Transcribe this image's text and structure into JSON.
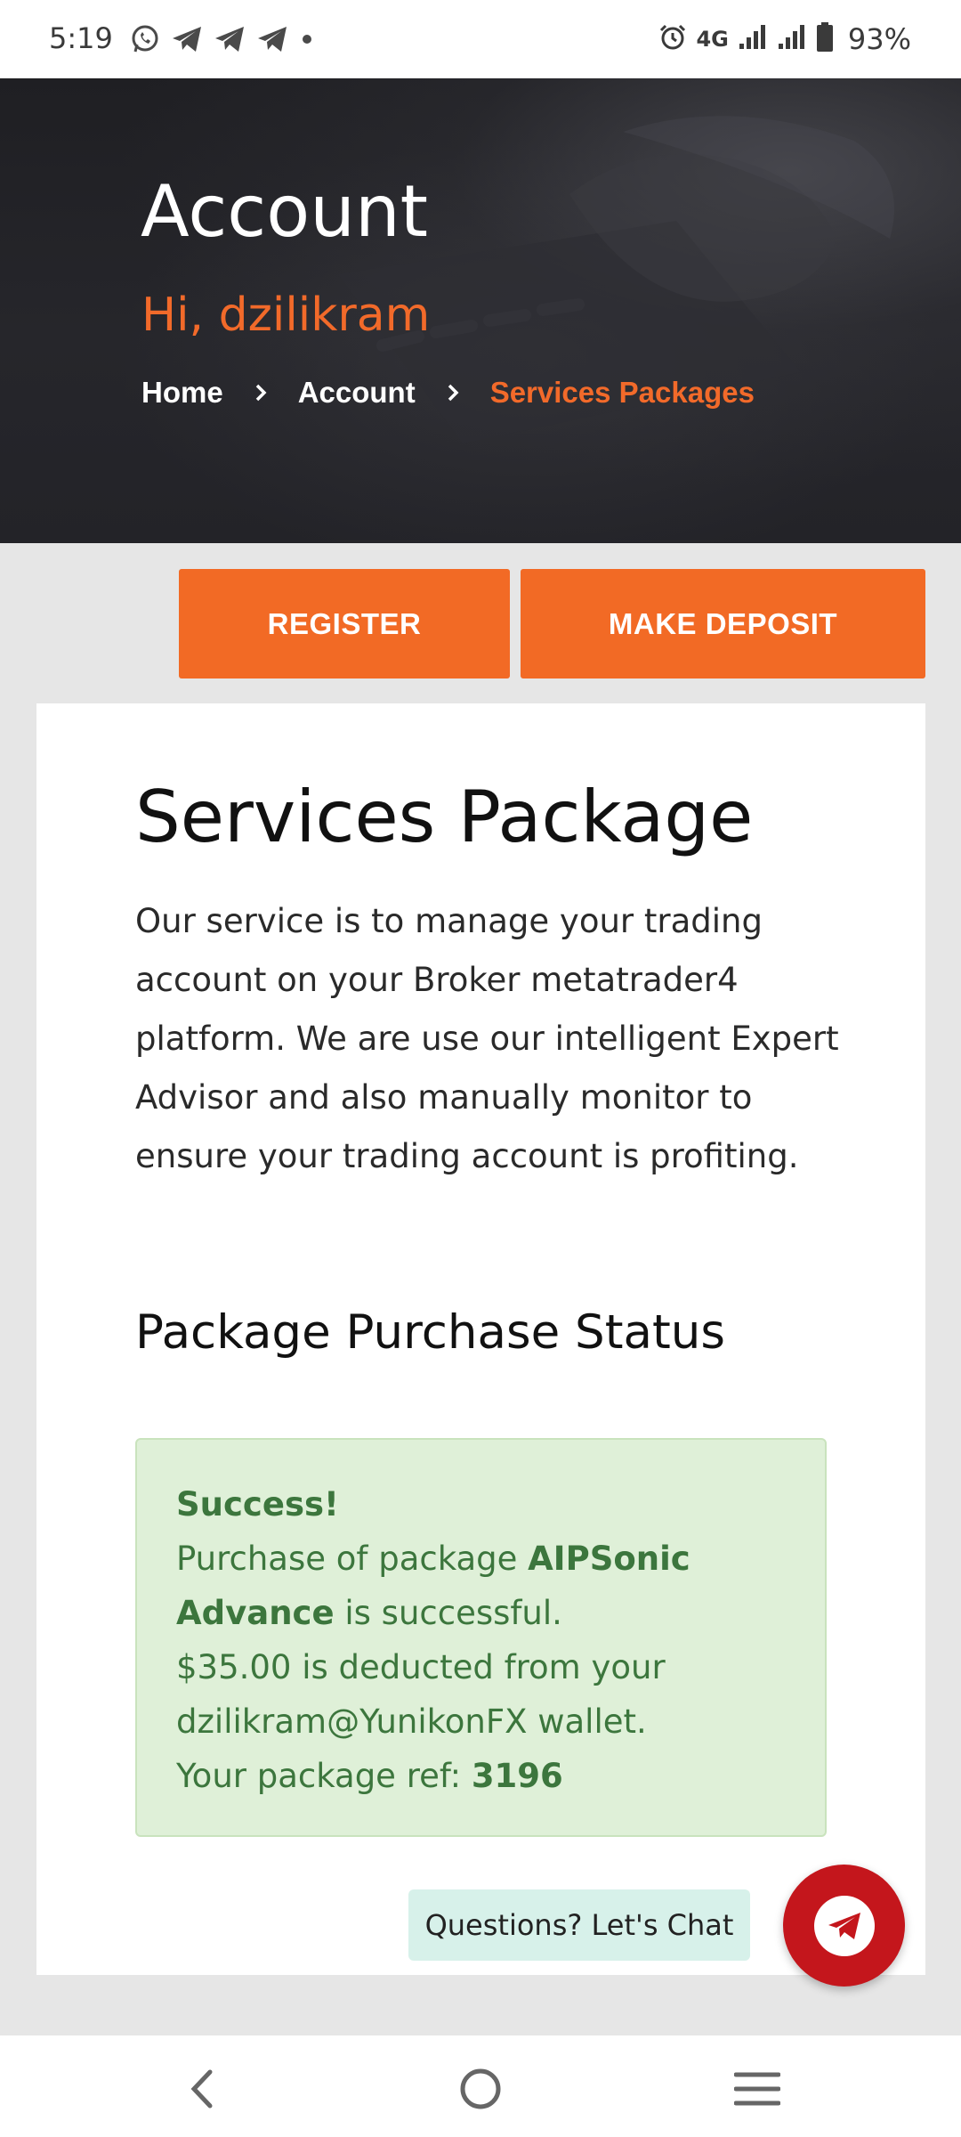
{
  "status_bar": {
    "time": "5:19",
    "network": "4G",
    "battery": "93%",
    "icons": [
      "whatsapp-icon",
      "telegram-icon",
      "telegram-icon",
      "telegram-icon",
      "alarm-icon",
      "signal-icon",
      "signal-icon",
      "battery-icon"
    ]
  },
  "hero": {
    "title": "Account",
    "greeting": "Hi, dzilikram",
    "breadcrumb": [
      "Home",
      "Account",
      "Services Packages"
    ]
  },
  "buttons": {
    "register": "REGISTER",
    "deposit": "MAKE DEPOSIT"
  },
  "card": {
    "title": "Services Package",
    "description": "Our service is to manage your trading account on your Broker metatrader4 platform. We are use our intelligent Expert Advisor and also manually monitor to ensure your trading account is profiting.",
    "status_heading": "Package Purchase Status",
    "alert": {
      "title": "Success!",
      "purchase_prefix": "Purchase of package",
      "package_name": "AIPSonic Advance",
      "purchase_suffix": "is successful.",
      "amount": "$35.00",
      "deducted_text": "is deducted from your",
      "wallet": "dzilikram@YunikonFX",
      "wallet_suffix": "wallet.",
      "ref_label": "Your package ref:",
      "ref": "3196"
    }
  },
  "chat": {
    "label": "Questions? Let's Chat"
  },
  "colors": {
    "accent": "#f26a25",
    "success_bg": "#dff0d8",
    "success_text": "#3c763d",
    "chat_red": "#c4161c"
  }
}
